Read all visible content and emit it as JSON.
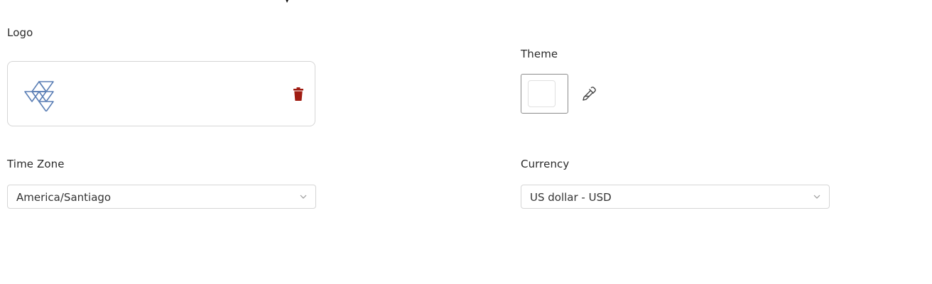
{
  "logo": {
    "label": "Logo",
    "mark_icon": "triangle-grid-logo-icon",
    "delete_icon": "trash-icon",
    "mark_color": "#5b7fb5",
    "delete_color": "#a01c12"
  },
  "theme": {
    "label": "Theme",
    "swatch_color": "#ffffff",
    "picker_icon": "eyedropper-icon"
  },
  "time_zone": {
    "label": "Time Zone",
    "value": "America/Santiago",
    "chevron_icon": "chevron-down-icon"
  },
  "currency": {
    "label": "Currency",
    "value": "US dollar - USD",
    "chevron_icon": "chevron-down-icon"
  }
}
